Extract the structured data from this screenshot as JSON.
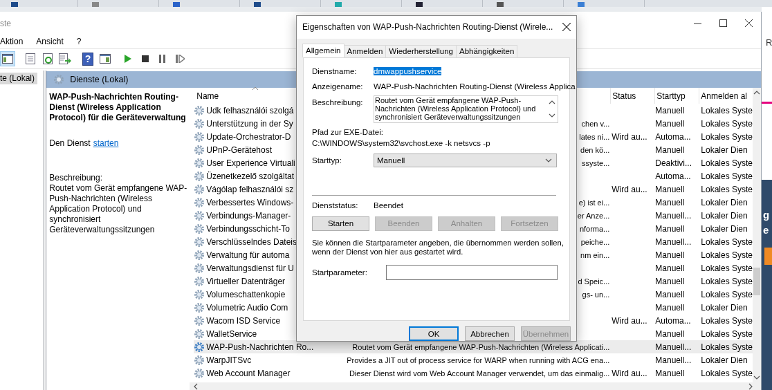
{
  "window": {
    "title": "ste"
  },
  "menu": [
    {
      "label": "Aktion"
    },
    {
      "label": "Ansicht"
    },
    {
      "label": "?"
    }
  ],
  "toolbar": [
    {
      "kind": "console-tree",
      "on": true
    },
    {
      "kind": "properties",
      "on": false
    },
    {
      "kind": "refresh",
      "on": false
    },
    {
      "kind": "export",
      "on": false
    },
    {
      "kind": "help",
      "glyph": "?",
      "on": false
    },
    {
      "kind": "view",
      "on": false
    },
    {
      "kind": "start",
      "on": false
    },
    {
      "kind": "stop",
      "on": false
    },
    {
      "kind": "pause",
      "on": false
    },
    {
      "kind": "resume",
      "on": false
    }
  ],
  "tree": [
    {
      "label": "te (Lokal)",
      "selected": true
    }
  ],
  "pane_header": "Dienste (Lokal)",
  "details": {
    "title": "WAP-Push-Nachrichten Routing-Dienst (Wireless Application Protocol) für die Geräteverwaltung",
    "action_text": "Den Dienst",
    "action_link": "starten",
    "description_label": "Beschreibung:",
    "description": "Routet vom Gerät empfangene WAP-Push-Nachrichten (Wireless Application Protocol) und synchronisiert Geräteverwaltungssitzungen"
  },
  "table": {
    "columns": [
      {
        "label": "Name",
        "sorted": true
      },
      {
        "label": "Status",
        "sorted": false
      },
      {
        "label": "Starttyp",
        "sorted": false
      },
      {
        "label": "Anmelden al",
        "sorted": false
      }
    ],
    "rows": [
      {
        "name": "Udk felhasználói szolgá",
        "description": "",
        "status": "",
        "startup": "Manuell",
        "logon": "Lokales Syste",
        "selected": false
      },
      {
        "name": "Unterstützung in der Sy",
        "description": "chen v...",
        "status": "",
        "startup": "Manuell",
        "logon": "Lokales Syste",
        "selected": false
      },
      {
        "name": "Update-Orchestrator-D",
        "description": "lates ni...",
        "status": "Wird au...",
        "startup": "Automa...",
        "logon": "Lokales Syste",
        "selected": false
      },
      {
        "name": "UPnP-Gerätehost",
        "description": "den kö...",
        "status": "",
        "startup": "Manuell",
        "logon": "Lokaler Dien",
        "selected": false
      },
      {
        "name": "User Experience Virtuali",
        "description": "ssyste...",
        "status": "",
        "startup": "Deaktivi...",
        "logon": "Lokales Syste",
        "selected": false
      },
      {
        "name": "Üzenetkezelő szolgáltat",
        "description": "",
        "status": "",
        "startup": "Automa...",
        "logon": "Lokales Syste",
        "selected": false
      },
      {
        "name": "Vágólap felhasználói sz",
        "description": "",
        "status": "Wird au...",
        "startup": "Manuell",
        "logon": "Lokales Syste",
        "selected": false
      },
      {
        "name": "Verbessertes Windows-",
        "description": "e) ist ei...",
        "status": "",
        "startup": "Manuell",
        "logon": "Lokaler Dien",
        "selected": false
      },
      {
        "name": "Verbindungs-Manager-",
        "description": "er Anze...",
        "status": "",
        "startup": "Manuell...",
        "logon": "Lokaler Dien",
        "selected": false
      },
      {
        "name": "Verbindungsschicht-To",
        "description": "nforma...",
        "status": "",
        "startup": "Manuell",
        "logon": "Lokaler Dien",
        "selected": false
      },
      {
        "name": "Verschlüsselndes Dateis",
        "description": "peiche...",
        "status": "",
        "startup": "Manuell...",
        "logon": "Lokales Syste",
        "selected": false
      },
      {
        "name": "Verwaltung für automa",
        "description": "nm ein...",
        "status": "",
        "startup": "Manuell",
        "logon": "Lokales Syste",
        "selected": false
      },
      {
        "name": "Verwaltungsdienst für U",
        "description": "",
        "status": "",
        "startup": "Manuell",
        "logon": "Lokales Syste",
        "selected": false
      },
      {
        "name": "Virtueller Datenträger",
        "description": "d Speic...",
        "status": "",
        "startup": "Manuell",
        "logon": "Lokales Syste",
        "selected": false
      },
      {
        "name": "Volumeschattenkopie",
        "description": "gs- un...",
        "status": "",
        "startup": "Manuell",
        "logon": "Lokales Syste",
        "selected": false
      },
      {
        "name": "Volumetric Audio Com",
        "description": "",
        "status": "",
        "startup": "Manuell",
        "logon": "Lokaler Dien",
        "selected": false
      },
      {
        "name": "Wacom ISD Service",
        "description": "",
        "status": "Wird au...",
        "startup": "Automa...",
        "logon": "Lokales Syste",
        "selected": false
      },
      {
        "name": "WalletService",
        "description": "",
        "status": "",
        "startup": "Manuell",
        "logon": "Lokales Syste",
        "selected": false
      },
      {
        "name": "WAP-Push-Nachrichten Ro...",
        "description": "Routet vom Gerät empfangene WAP-Push-Nachrichten (Wireless Applicati...",
        "status": "",
        "startup": "Manuell...",
        "logon": "Lokales Syste",
        "selected": true
      },
      {
        "name": "WarpJITSvc",
        "description": "Provides a JIT out of process service for WARP when running with ACG ena...",
        "status": "",
        "startup": "Manuell...",
        "logon": "Lokaler Dien",
        "selected": false
      },
      {
        "name": "Web Account Manager",
        "description": "Dieser Dienst wird vom Web Account Manager verwendet, um das einmalig...",
        "status": "Wird au...",
        "startup": "Manuell",
        "logon": "Lokales Syste",
        "selected": false
      }
    ]
  },
  "backdrop": {
    "top_letter": "R",
    "letters": [
      "g",
      "e"
    ]
  },
  "dialog": {
    "title": "Eigenschaften von WAP-Push-Nachrichten Routing-Dienst (Wirele...",
    "tabs": [
      {
        "label": "Allgemein",
        "selected": true
      },
      {
        "label": "Anmelden",
        "selected": false
      },
      {
        "label": "Wiederherstellung",
        "selected": false
      },
      {
        "label": "Abhängigkeiten",
        "selected": false
      }
    ],
    "service_name_label": "Dienstname:",
    "service_name": "dmwappushservice",
    "service_name_highlighted": true,
    "display_name_label": "Anzeigename:",
    "display_name": "WAP-Push-Nachrichten Routing-Dienst (Wireless Applica",
    "description_label": "Beschreibung:",
    "description": "Routet vom Gerät empfangene WAP-Push-Nachrichten (Wireless Application Protocol) und synchronisiert Geräteverwaltungssitzungen",
    "path_label": "Pfad zur EXE-Datei:",
    "path": "C:\\WINDOWS\\system32\\svchost.exe -k netsvcs -p",
    "startup_label": "Starttyp:",
    "startup": "Manuell",
    "status_label": "Dienststatus:",
    "status": "Beendet",
    "service_buttons": [
      {
        "label": "Starten",
        "disabled": false
      },
      {
        "label": "Beenden",
        "disabled": true
      },
      {
        "label": "Anhalten",
        "disabled": true
      },
      {
        "label": "Fortsetzen",
        "disabled": true
      }
    ],
    "hint": "Sie können die Startparameter angeben, die übernommen werden sollen, wenn der Dienst von hier aus gestartet wird.",
    "params_label": "Startparameter:",
    "buttons": [
      {
        "label": "OK",
        "default": true,
        "disabled": false
      },
      {
        "label": "Abbrechen",
        "default": false,
        "disabled": false
      },
      {
        "label": "Übernehmen",
        "default": false,
        "disabled": true
      }
    ]
  }
}
